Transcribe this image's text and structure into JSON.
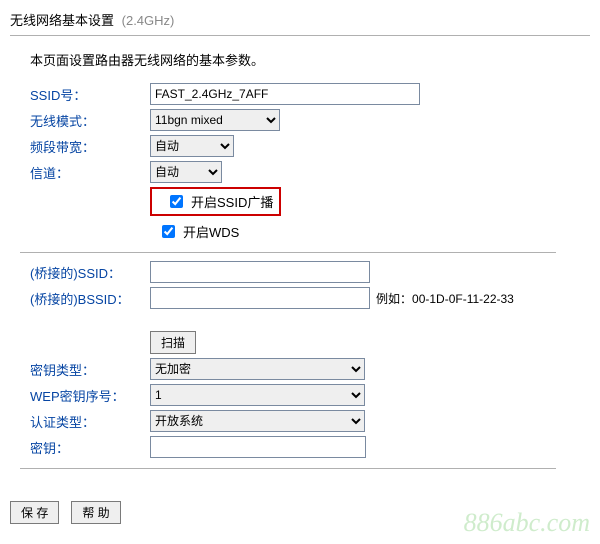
{
  "header": {
    "title_cn": "无线网络基本设置",
    "title_ghz": "(2.4GHz)"
  },
  "intro": "本页面设置路由器无线网络的基本参数。",
  "fields": {
    "ssid": {
      "label": "SSID号：",
      "value": "FAST_2.4GHz_7AFF"
    },
    "wireless_mode": {
      "label": "无线模式：",
      "selected": "11bgn mixed"
    },
    "bandwidth": {
      "label": "频段带宽：",
      "selected": "自动"
    },
    "channel": {
      "label": "信道：",
      "selected": "自动"
    },
    "enable_ssid_broadcast": {
      "label": "开启SSID广播",
      "checked": true
    },
    "enable_wds": {
      "label": "开启WDS",
      "checked": true
    },
    "bridge_ssid": {
      "label": "(桥接的)SSID：",
      "value": ""
    },
    "bridge_bssid": {
      "label": "(桥接的)BSSID：",
      "value": "",
      "example_prefix": "例如：",
      "example_val": "00-1D-0F-11-22-33"
    },
    "scan_button": "扫描",
    "key_type": {
      "label": "密钥类型：",
      "selected": "无加密"
    },
    "wep_key_index": {
      "label": "WEP密钥序号：",
      "selected": "1"
    },
    "auth_type": {
      "label": "认证类型：",
      "selected": "开放系统"
    },
    "key": {
      "label": "密钥：",
      "value": ""
    }
  },
  "footer": {
    "save": "保 存",
    "help": "帮 助"
  },
  "watermark": "886abc.com"
}
